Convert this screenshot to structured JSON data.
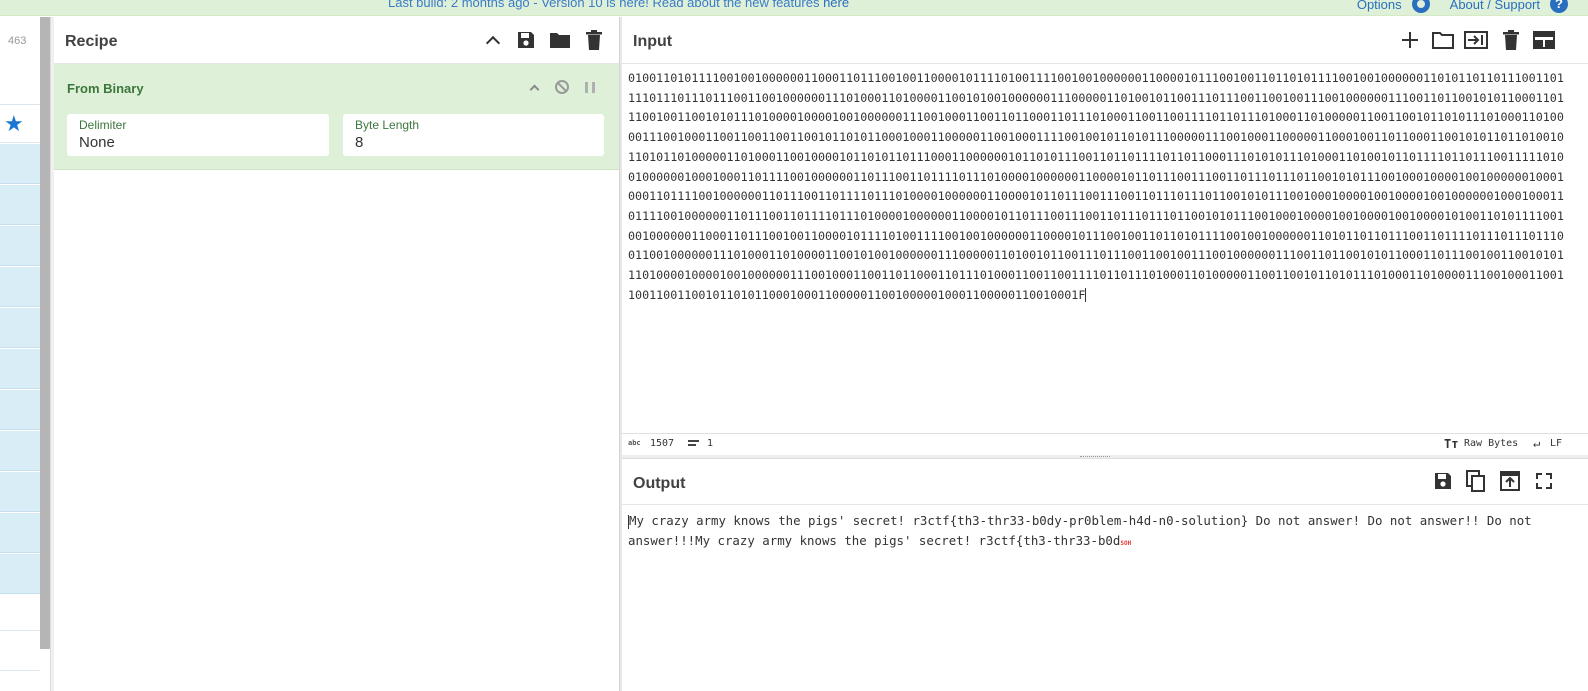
{
  "banner": {
    "message": "Last build: 2 months ago - Version 10 is here! Read about the new features ",
    "link": "here",
    "options": "Options",
    "about": "About / Support"
  },
  "operations": {
    "count": "463"
  },
  "recipe": {
    "title": "Recipe",
    "operation": {
      "name": "From Binary",
      "fields": [
        {
          "label": "Delimiter",
          "value": "None"
        },
        {
          "label": "Byte Length",
          "value": "8"
        }
      ]
    }
  },
  "input": {
    "title": "Input",
    "text": "010011010111100100100000011000110111001001100001011110100111100100100000011000010111001001101101011110010010000001101011011011100110111101110111011100110010000001110100011010000110010100100000011100000110100101100111011100110010011100100000011100110110010101100011011100100110010101110100001000010010000001110010001100110110001101110100011001100111101101110100011010000011001100101101011101000110100001110010001100110011001100101101011000100011000001100100011110010010110101110000011100100011000001100010011011000110010101101101001011010110100000110100011001000010110101101110001100000010110101110011011011110110110001110101011101000110100101101111011011100111110100100000010001000110111100100000011011100110111101110100001000000110000101101110011100110111011101100101011100100010000100100000010001000110111100100000011011100110111101110100001000000110000101101110011100110111011101100101011100100010000100100001001000000100010001101111001000000110111001101111011101000010000001100001011011100111001101110111011001010111001000100001001000010010000101001101011110010010000001100011011100100110000101111010011110010010000001100001011100100110110101111001001000000110101101101110011011110111011101110011001000000111010001101000011001010010000001110000011010010110011101110011001001110010000001110011011001010110001101110010011001010111010000100001001000000111001000110011011000110111010001100110011110110111010001101000001100110010110101110100011010000111001000110011001100110010110101100010001100000110010000010001100000110010001F",
    "stats": {
      "length": "1507",
      "lines": "1",
      "encoding": "Raw Bytes",
      "eol": "LF"
    }
  },
  "output": {
    "title": "Output",
    "text": "My crazy army knows the pigs' secret! r3ctf{th3-thr33-b0dy-pr0blem-h4d-n0-solution} Do not answer! Do not answer!! Do not answer!!!My crazy army knows the pigs' secret! r3ctf{th3-thr33-b0d",
    "control_char": "SOH"
  },
  "colors": {
    "banner_bg": "#dff0d8",
    "link": "#2a6fbf",
    "op_bg": "#dff0d8",
    "op_text": "#3c763d",
    "fav_star": "#1976d2",
    "ops_row": "#d9edf7",
    "control_char": "#e53935"
  },
  "icons": [
    "gear-icon",
    "help-icon",
    "star-icon",
    "chevron-up-icon",
    "save-icon",
    "folder-icon",
    "trash-icon",
    "disable-icon",
    "pause-icon",
    "plus-icon",
    "open-folder-icon",
    "input-to-tab-icon",
    "layout-icon",
    "copy-icon",
    "replace-input-icon",
    "maximize-icon",
    "lines-icon",
    "font-icon",
    "return-icon"
  ]
}
